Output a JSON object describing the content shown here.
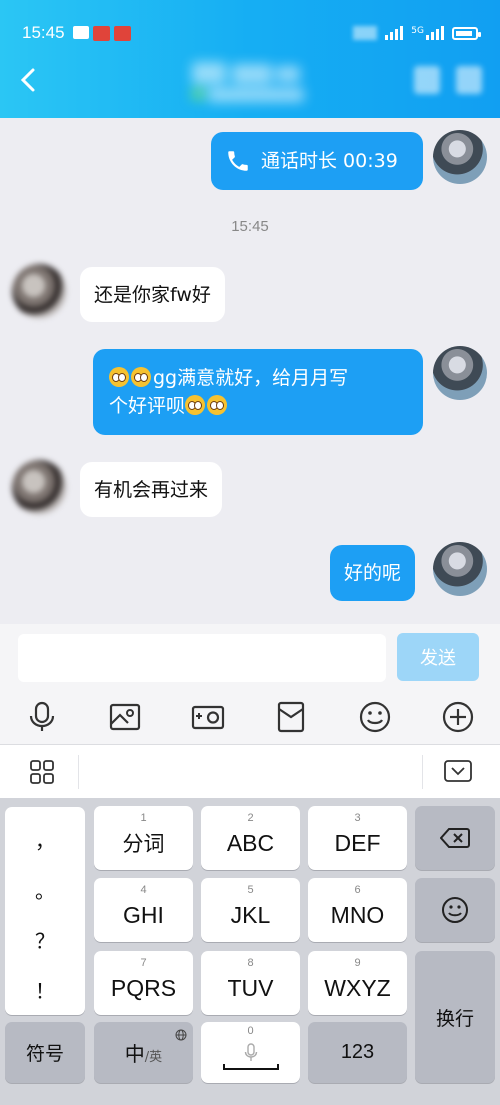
{
  "status_bar": {
    "time": "15:45",
    "network": "5G"
  },
  "header": {
    "back_label": "Back"
  },
  "chat": {
    "messages": [
      {
        "direction": "out",
        "type": "call",
        "text": "通话时长 00:39"
      },
      {
        "direction": "time",
        "text": "15:45"
      },
      {
        "direction": "in",
        "text": "还是你家fw好"
      },
      {
        "direction": "out",
        "line1": "gg满意就好，给月月写",
        "line2": "个好评呗"
      },
      {
        "direction": "in",
        "text": "有机会再过来"
      },
      {
        "direction": "out",
        "text": "好的呢"
      }
    ]
  },
  "input": {
    "placeholder": "",
    "send_label": "发送"
  },
  "tools": [
    "microphone-icon",
    "image-icon",
    "camera-icon",
    "red-packet-icon",
    "emoji-icon",
    "plus-icon"
  ],
  "keyboard": {
    "punctuation": [
      "，",
      "。",
      "？",
      "！"
    ],
    "keys": [
      {
        "num": "1",
        "label": "分词"
      },
      {
        "num": "2",
        "label": "ABC"
      },
      {
        "num": "3",
        "label": "DEF"
      },
      {
        "num": "4",
        "label": "GHI"
      },
      {
        "num": "5",
        "label": "JKL"
      },
      {
        "num": "6",
        "label": "MNO"
      },
      {
        "num": "7",
        "label": "PQRS"
      },
      {
        "num": "8",
        "label": "TUV"
      },
      {
        "num": "9",
        "label": "WXYZ"
      }
    ],
    "symbols_label": "符号",
    "lang_label_main": "中",
    "lang_label_sub": "/英",
    "space_num": "0",
    "numbers_label": "123",
    "newline_label": "换行"
  },
  "colors": {
    "accent": "#1d9ff4",
    "header_start": "#2bc6f4",
    "send_disabled": "#9dd6f8"
  }
}
